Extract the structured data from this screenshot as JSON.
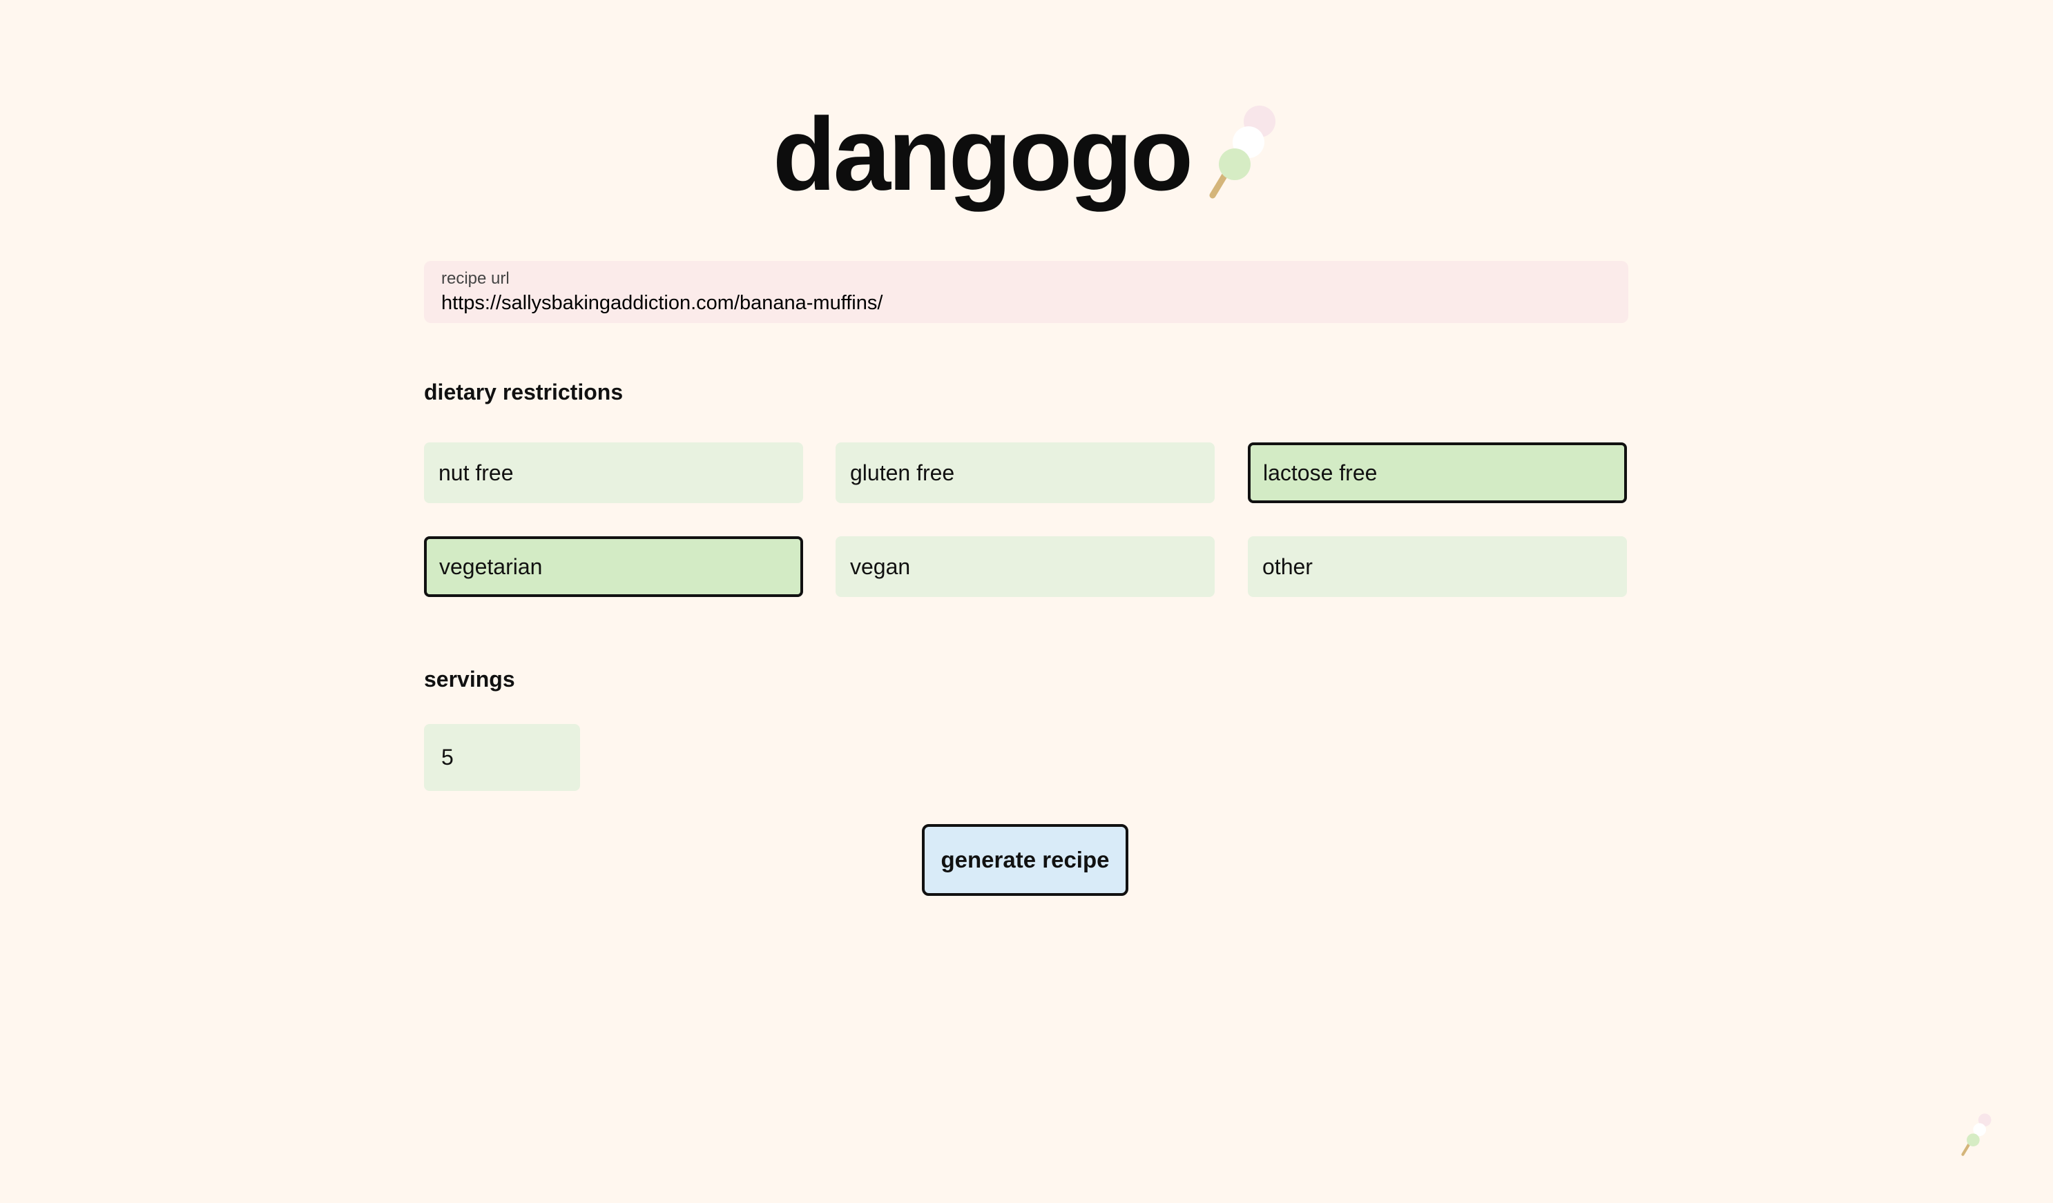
{
  "app": {
    "title": "dangogo",
    "logo_icon": "dango-icon"
  },
  "recipe_url": {
    "label": "recipe url",
    "value": "https://sallysbakingaddiction.com/banana-muffins/"
  },
  "dietary_restrictions": {
    "heading": "dietary restrictions",
    "options": [
      {
        "label": "nut free",
        "selected": false
      },
      {
        "label": "gluten free",
        "selected": false
      },
      {
        "label": "lactose free",
        "selected": true
      },
      {
        "label": "vegetarian",
        "selected": true
      },
      {
        "label": "vegan",
        "selected": false
      },
      {
        "label": "other",
        "selected": false
      }
    ]
  },
  "servings": {
    "heading": "servings",
    "value": "5"
  },
  "actions": {
    "generate_label": "generate recipe"
  },
  "colors": {
    "background": "#fff7ef",
    "url_field": "#fbebea",
    "option": "#e8f2e0",
    "option_selected": "#d3ebc5",
    "button": "#d9ebf8",
    "dango_pink": "#f8e6ea",
    "dango_white": "#ffffff",
    "dango_green": "#d6ecc4",
    "dango_stick": "#d4b57a"
  }
}
